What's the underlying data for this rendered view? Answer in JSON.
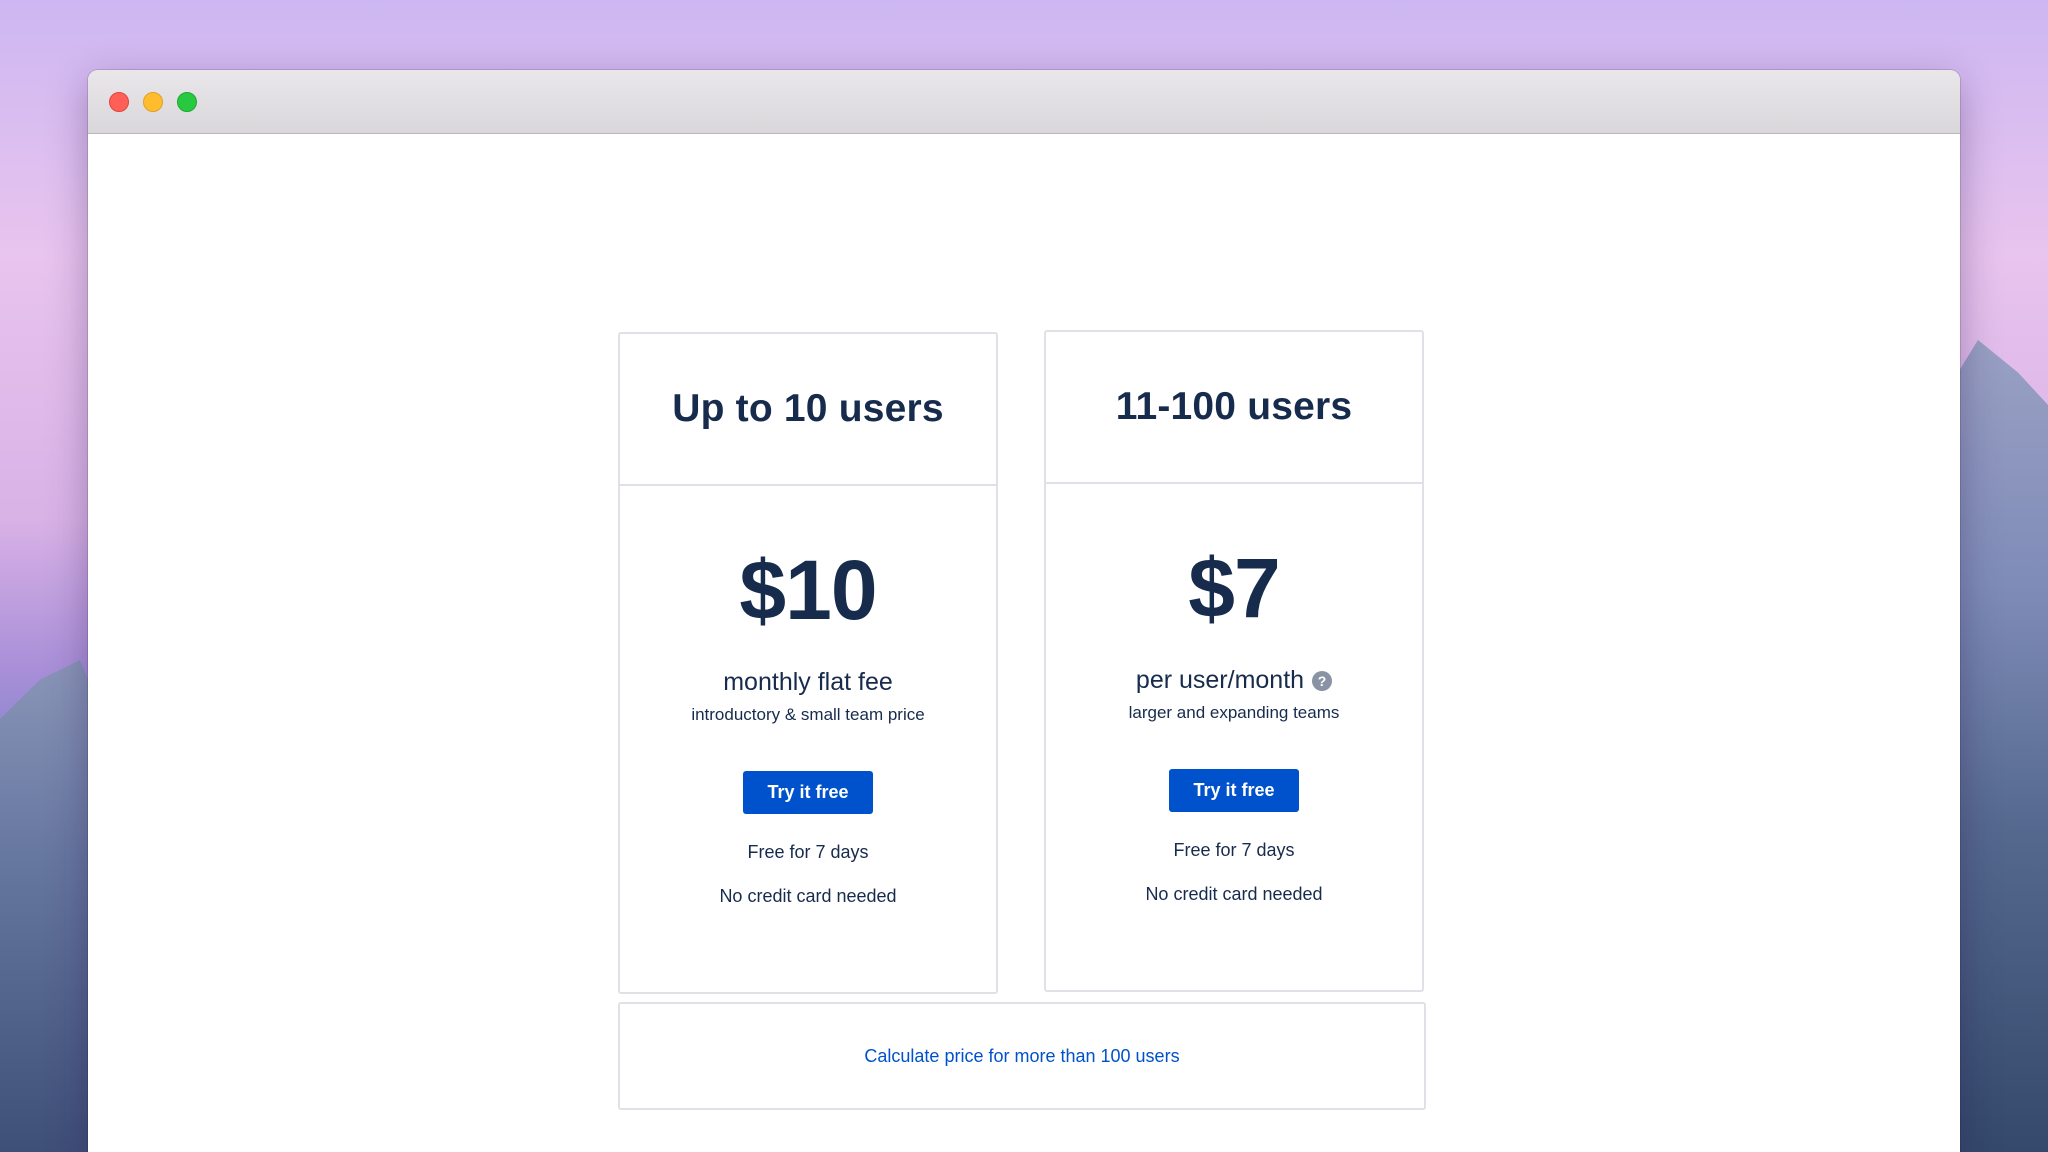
{
  "window": {
    "controls": {
      "close": "close-button",
      "minimize": "minimize-button",
      "zoom": "zoom-button"
    }
  },
  "plans": [
    {
      "title": "Up to 10 users",
      "price": "$10",
      "unit": "monthly flat fee",
      "note": "introductory & small team price",
      "cta": "Try it free",
      "features": [
        "Free for 7 days",
        "No credit card needed"
      ]
    },
    {
      "title": "11-100 users",
      "price": "$7",
      "unit": "per user/month",
      "help_icon": "?",
      "note": "larger and expanding teams",
      "cta": "Try it free",
      "features": [
        "Free for 7 days",
        "No credit card needed"
      ]
    }
  ],
  "calculator": {
    "link": "Calculate price for more than 100 users"
  },
  "colors": {
    "primary": "#0052cc",
    "text": "#172b4d",
    "border": "#dfe1e6",
    "help_icon": "#8993a4"
  },
  "icons": [
    "close-icon",
    "minimize-icon",
    "zoom-icon",
    "question-mark-icon"
  ]
}
